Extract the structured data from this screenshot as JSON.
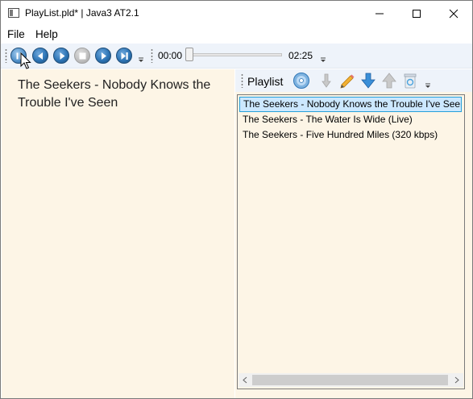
{
  "window": {
    "title": "PlayList.pld* | Java3 AT2.1"
  },
  "menu": {
    "file": "File",
    "help": "Help"
  },
  "player": {
    "current_time": "00:00",
    "total_time": "02:25",
    "position_fraction": 0.0,
    "buttons": [
      "pause-icon",
      "previous-icon",
      "play-icon",
      "stop-icon",
      "next-icon",
      "skip-end-icon"
    ]
  },
  "now_playing": {
    "title": "The Seekers - Nobody Knows the Trouble I've Seen"
  },
  "playlist": {
    "label": "Playlist",
    "items": [
      "The Seekers - Nobody Knows the Trouble I've Seen",
      "The Seekers - The Water Is Wide (Live)",
      "The Seekers - Five Hundred Miles (320 kbps)"
    ],
    "selected_index": 0
  },
  "colors": {
    "panel_background": "#fdf5e6",
    "toolbar_background": "#eef3fa",
    "selection_background": "#cce8ff",
    "selection_border": "#26a0da",
    "accent_blue": "#2e75b6"
  }
}
